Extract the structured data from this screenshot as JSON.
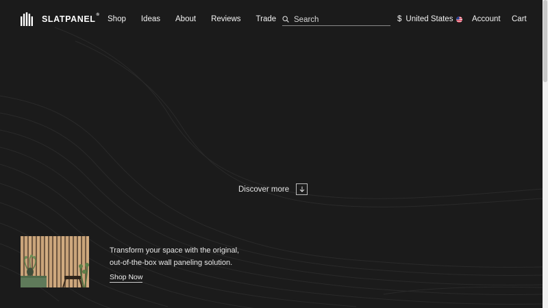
{
  "brand": {
    "name": "SLATPANEL",
    "registered_mark": "®"
  },
  "nav": {
    "items": [
      "Shop",
      "Ideas",
      "About",
      "Reviews",
      "Trade"
    ]
  },
  "search": {
    "placeholder": "Search",
    "icon": "search-icon"
  },
  "locale": {
    "currency_symbol": "$",
    "country": "United States",
    "flag": "us-flag-icon"
  },
  "account": {
    "label": "Account"
  },
  "cart": {
    "label": "Cart"
  },
  "hero": {
    "discover_label": "Discover more",
    "discover_icon": "arrow-down-icon"
  },
  "promo": {
    "line1": "Transform your space with the original,",
    "line2": "out-of-the-box wall paneling solution.",
    "cta": "Shop Now"
  },
  "colors": {
    "background": "#1b1b1b",
    "text": "#f2f2f2",
    "wave": "#2b2b2b"
  }
}
